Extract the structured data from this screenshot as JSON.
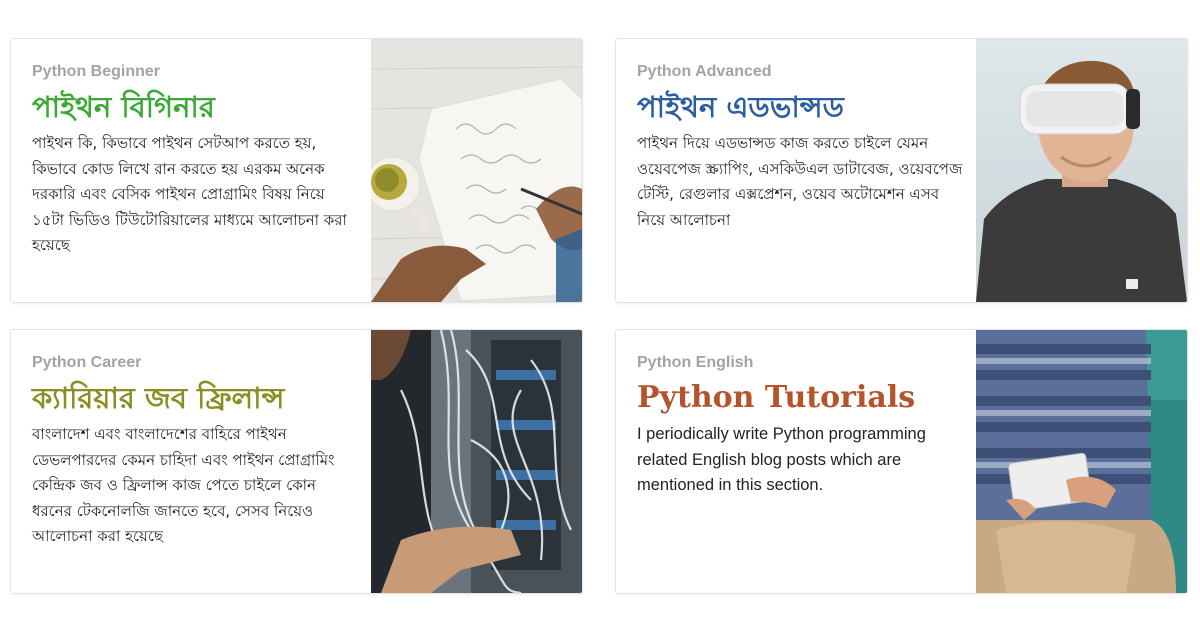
{
  "cards": [
    {
      "eyebrow": "Python Beginner",
      "title": "পাইথন বিগিনার",
      "title_color": "#3aaa35",
      "description": "পাইথন কি, কিভাবে পাইথন সেটআপ করতে হয়, কিভাবে কোড লিখে রান করতে হয় এরকম অনেক দরকারি এবং বেসিক পাইথন প্রোগ্রামিং বিষয় নিয়ে ১৫টা ভিডিও টিউটোরিয়ালের মাধ্যমে আলোচনা করা হয়েছে",
      "image": "notebook-writing-photo"
    },
    {
      "eyebrow": "Python Advanced",
      "title": "পাইথন এডভান্সড",
      "title_color": "#2b5ea0",
      "description": "পাইথন দিয়ে এডভান্সড কাজ করতে চাইলে যেমন ওয়েবপেজ স্ক্র্যাপিং, এসকিউএল ডাটাবেজ, ওয়েবপেজ টেস্টি, রেগুলার এক্সপ্রেশন, ওয়েব অটোমেশন এসব নিয়ে আলোচনা",
      "image": "vr-headset-photo"
    },
    {
      "eyebrow": "Python Career",
      "title": "ক্যারিয়ার জব ফ্রিলান্স",
      "title_color": "#8a8f24",
      "description": "বাংলাদেশ এবং বাংলাদেশের বাহিরে পাইথন ডেভলপারদের কেমন চাহিদা এবং পাইথন প্রোগ্রামিং কেন্দ্রিক জব ও ফ্রিলান্স কাজ পেতে চাইলে কোন ধরনের টেকনোলজি জানতে হবে, সেসব নিয়েও আলোচনা করা হয়েছে",
      "image": "server-cables-photo"
    },
    {
      "eyebrow": "Python English",
      "title": "Python Tutorials",
      "title_color": "#b5532a",
      "description": "I periodically write Python programming related English blog posts which are mentioned in this section.",
      "image": "tablet-reader-photo"
    }
  ]
}
